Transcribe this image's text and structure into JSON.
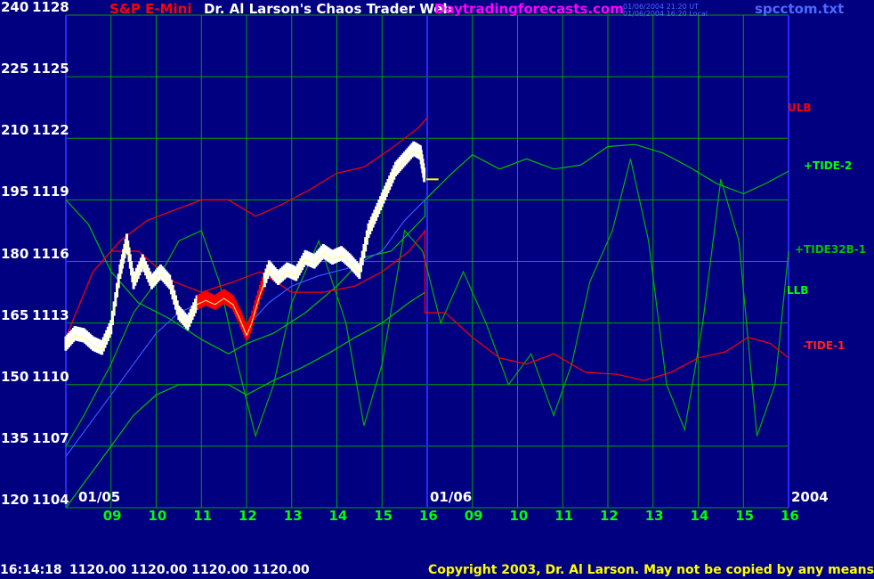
{
  "header": {
    "symbol": "S&P E-Mini",
    "title": "Dr. Al Larson's Chaos Trader Web",
    "site": "Daytradingforecasts.com",
    "stamp_ut": "01/06/2004 21:20 UT",
    "stamp_local": "01/06/2004 16:20 Local",
    "file": "spcctom.txt"
  },
  "footer": {
    "time": "16:14:18",
    "ohlc": "1120.00 1120.00 1120.00 1120.00",
    "copyright": "Copyright 2003, Dr. Al Larson. May not be copied by any means."
  },
  "colors": {
    "background": "#000080",
    "grid": "#00a000",
    "price_up": "#ffffff",
    "price_down": "#ff0000",
    "ulb_line": "#ff0000",
    "tide_line": "#00c000",
    "day_divider": "#2828ff"
  },
  "chart_data": {
    "type": "line",
    "y_labels": [
      {
        "osc": "240",
        "price": "1128"
      },
      {
        "osc": "225",
        "price": "1125"
      },
      {
        "osc": "210",
        "price": "1122"
      },
      {
        "osc": "195",
        "price": "1119"
      },
      {
        "osc": "180",
        "price": "1116"
      },
      {
        "osc": "165",
        "price": "1113"
      },
      {
        "osc": "150",
        "price": "1110"
      },
      {
        "osc": "135",
        "price": "1107"
      },
      {
        "osc": "120",
        "price": "1104"
      }
    ],
    "ylim_price": [
      1104,
      1128
    ],
    "ylim_osc": [
      120,
      240
    ],
    "x_ticks": [
      "09",
      "10",
      "11",
      "12",
      "13",
      "14",
      "15",
      "16",
      "09",
      "10",
      "11",
      "12",
      "13",
      "14",
      "15",
      "16"
    ],
    "date_labels": [
      "01/05",
      "01/06"
    ],
    "year": "2004",
    "grid": true,
    "curve_labels": [
      {
        "name": "ULB",
        "color": "#ff0000"
      },
      {
        "name": "+TIDE-2",
        "color": "#00ff00"
      },
      {
        "name": "+TIDE32B-1",
        "color": "#00c000"
      },
      {
        "name": "LLB",
        "color": "#00ff00"
      },
      {
        "name": "-TIDE-1",
        "color": "#ff2020"
      }
    ],
    "last_price": 1120.0,
    "price_series": [
      {
        "x": 0.0,
        "y": 1112.0
      },
      {
        "x": 0.2,
        "y": 1112.5
      },
      {
        "x": 0.4,
        "y": 1112.4
      },
      {
        "x": 0.6,
        "y": 1112.0
      },
      {
        "x": 0.8,
        "y": 1111.8
      },
      {
        "x": 1.0,
        "y": 1112.8
      },
      {
        "x": 1.2,
        "y": 1115.5
      },
      {
        "x": 1.35,
        "y": 1117.0
      },
      {
        "x": 1.5,
        "y": 1115.0
      },
      {
        "x": 1.7,
        "y": 1116.0
      },
      {
        "x": 1.9,
        "y": 1115.0
      },
      {
        "x": 2.1,
        "y": 1115.5
      },
      {
        "x": 2.3,
        "y": 1115.0
      },
      {
        "x": 2.5,
        "y": 1113.5
      },
      {
        "x": 2.7,
        "y": 1113.0
      },
      {
        "x": 2.9,
        "y": 1114.0
      },
      {
        "x": 3.1,
        "y": 1114.2
      },
      {
        "x": 3.3,
        "y": 1114.0
      },
      {
        "x": 3.5,
        "y": 1114.3
      },
      {
        "x": 3.7,
        "y": 1114.0
      },
      {
        "x": 3.85,
        "y": 1113.3
      },
      {
        "x": 4.0,
        "y": 1112.5
      },
      {
        "x": 4.1,
        "y": 1113.0
      },
      {
        "x": 4.3,
        "y": 1114.5
      },
      {
        "x": 4.5,
        "y": 1115.7
      },
      {
        "x": 4.7,
        "y": 1115.2
      },
      {
        "x": 4.9,
        "y": 1115.6
      },
      {
        "x": 5.1,
        "y": 1115.4
      },
      {
        "x": 5.3,
        "y": 1116.2
      },
      {
        "x": 5.5,
        "y": 1116.0
      },
      {
        "x": 5.7,
        "y": 1116.5
      },
      {
        "x": 5.9,
        "y": 1116.2
      },
      {
        "x": 6.1,
        "y": 1116.4
      },
      {
        "x": 6.3,
        "y": 1116.0
      },
      {
        "x": 6.5,
        "y": 1115.5
      },
      {
        "x": 6.7,
        "y": 1117.5
      },
      {
        "x": 6.9,
        "y": 1118.5
      },
      {
        "x": 7.1,
        "y": 1119.5
      },
      {
        "x": 7.3,
        "y": 1120.5
      },
      {
        "x": 7.5,
        "y": 1121.0
      },
      {
        "x": 7.7,
        "y": 1121.5
      },
      {
        "x": 7.85,
        "y": 1121.3
      },
      {
        "x": 7.95,
        "y": 1120.0
      }
    ],
    "ulb_series": [
      {
        "x": 0.0,
        "y": 1112.3
      },
      {
        "x": 0.6,
        "y": 1115.5
      },
      {
        "x": 1.2,
        "y": 1117.0
      },
      {
        "x": 1.8,
        "y": 1118.0
      },
      {
        "x": 2.4,
        "y": 1118.5
      },
      {
        "x": 3.0,
        "y": 1119.0
      },
      {
        "x": 3.6,
        "y": 1119.0
      },
      {
        "x": 4.2,
        "y": 1118.2
      },
      {
        "x": 4.8,
        "y": 1118.8
      },
      {
        "x": 5.4,
        "y": 1119.5
      },
      {
        "x": 6.0,
        "y": 1120.3
      },
      {
        "x": 6.6,
        "y": 1120.6
      },
      {
        "x": 7.2,
        "y": 1121.5
      },
      {
        "x": 7.8,
        "y": 1122.5
      },
      {
        "x": 8.0,
        "y": 1123.0
      }
    ],
    "price_band_series": [
      {
        "x": 1.0,
        "y": 1116.5
      },
      {
        "x": 1.6,
        "y": 1116.5
      },
      {
        "x": 2.4,
        "y": 1115.0
      },
      {
        "x": 3.0,
        "y": 1114.5
      },
      {
        "x": 3.7,
        "y": 1115.0
      },
      {
        "x": 4.3,
        "y": 1115.5
      },
      {
        "x": 5.0,
        "y": 1114.5
      },
      {
        "x": 5.7,
        "y": 1114.5
      },
      {
        "x": 6.4,
        "y": 1114.8
      },
      {
        "x": 7.0,
        "y": 1115.5
      },
      {
        "x": 7.6,
        "y": 1116.5
      },
      {
        "x": 7.95,
        "y": 1117.5
      },
      {
        "x": 7.95,
        "y": 1113.5
      },
      {
        "x": 8.4,
        "y": 1113.5
      },
      {
        "x": 9.0,
        "y": 1112.3
      },
      {
        "x": 9.6,
        "y": 1111.3
      },
      {
        "x": 10.2,
        "y": 1111.0
      },
      {
        "x": 10.8,
        "y": 1111.5
      },
      {
        "x": 11.5,
        "y": 1110.6
      },
      {
        "x": 12.2,
        "y": 1110.5
      },
      {
        "x": 12.8,
        "y": 1110.2
      },
      {
        "x": 13.4,
        "y": 1110.6
      },
      {
        "x": 14.0,
        "y": 1111.3
      },
      {
        "x": 14.6,
        "y": 1111.6
      },
      {
        "x": 15.1,
        "y": 1112.3
      },
      {
        "x": 15.6,
        "y": 1112.0
      },
      {
        "x": 16.0,
        "y": 1111.3
      }
    ],
    "tide2_series": [
      {
        "x": 0.0,
        "y": 1119.0
      },
      {
        "x": 0.5,
        "y": 1117.8
      },
      {
        "x": 1.0,
        "y": 1115.5
      },
      {
        "x": 1.6,
        "y": 1114.0
      },
      {
        "x": 2.3,
        "y": 1113.2
      },
      {
        "x": 3.0,
        "y": 1112.2
      },
      {
        "x": 3.6,
        "y": 1111.5
      },
      {
        "x": 4.0,
        "y": 1112.0
      },
      {
        "x": 4.6,
        "y": 1112.5
      },
      {
        "x": 5.3,
        "y": 1113.5
      },
      {
        "x": 6.0,
        "y": 1114.8
      },
      {
        "x": 6.6,
        "y": 1116.2
      },
      {
        "x": 7.2,
        "y": 1116.5
      },
      {
        "x": 7.95,
        "y": 1118.2
      },
      {
        "x": 7.95,
        "y": 1119.0
      },
      {
        "x": 8.5,
        "y": 1120.2
      },
      {
        "x": 9.0,
        "y": 1121.2
      },
      {
        "x": 9.6,
        "y": 1120.5
      },
      {
        "x": 10.2,
        "y": 1121.0
      },
      {
        "x": 10.8,
        "y": 1120.5
      },
      {
        "x": 11.4,
        "y": 1120.7
      },
      {
        "x": 12.0,
        "y": 1121.6
      },
      {
        "x": 12.6,
        "y": 1121.7
      },
      {
        "x": 13.2,
        "y": 1121.3
      },
      {
        "x": 13.8,
        "y": 1120.6
      },
      {
        "x": 14.4,
        "y": 1119.8
      },
      {
        "x": 15.0,
        "y": 1119.3
      },
      {
        "x": 15.5,
        "y": 1119.8
      },
      {
        "x": 16.0,
        "y": 1120.4
      }
    ],
    "tide32b_series": [
      {
        "x": 0.0,
        "y": 1107.0
      },
      {
        "x": 0.4,
        "y": 1108.5
      },
      {
        "x": 1.0,
        "y": 1111.0
      },
      {
        "x": 1.5,
        "y": 1113.5
      },
      {
        "x": 2.0,
        "y": 1115.0
      },
      {
        "x": 2.5,
        "y": 1117.0
      },
      {
        "x": 3.0,
        "y": 1117.5
      },
      {
        "x": 3.4,
        "y": 1115.0
      },
      {
        "x": 3.8,
        "y": 1111.0
      },
      {
        "x": 4.2,
        "y": 1107.5
      },
      {
        "x": 4.6,
        "y": 1110.0
      },
      {
        "x": 5.0,
        "y": 1114.0
      },
      {
        "x": 5.6,
        "y": 1117.0
      },
      {
        "x": 6.2,
        "y": 1113.0
      },
      {
        "x": 6.6,
        "y": 1108.0
      },
      {
        "x": 7.0,
        "y": 1111.0
      },
      {
        "x": 7.5,
        "y": 1117.5
      },
      {
        "x": 7.9,
        "y": 1116.5
      },
      {
        "x": 8.3,
        "y": 1113.0
      },
      {
        "x": 8.8,
        "y": 1115.5
      },
      {
        "x": 9.3,
        "y": 1113.0
      },
      {
        "x": 9.8,
        "y": 1110.0
      },
      {
        "x": 10.3,
        "y": 1111.5
      },
      {
        "x": 10.8,
        "y": 1108.5
      },
      {
        "x": 11.2,
        "y": 1111.0
      },
      {
        "x": 11.6,
        "y": 1115.0
      },
      {
        "x": 12.1,
        "y": 1117.5
      },
      {
        "x": 12.5,
        "y": 1121.0
      },
      {
        "x": 12.9,
        "y": 1117.0
      },
      {
        "x": 13.3,
        "y": 1110.0
      },
      {
        "x": 13.7,
        "y": 1107.8
      },
      {
        "x": 14.1,
        "y": 1113.0
      },
      {
        "x": 14.5,
        "y": 1120.0
      },
      {
        "x": 14.9,
        "y": 1117.0
      },
      {
        "x": 15.3,
        "y": 1107.5
      },
      {
        "x": 15.7,
        "y": 1110.0
      },
      {
        "x": 16.0,
        "y": 1116.5
      }
    ],
    "llb_series": [
      {
        "x": 0.0,
        "y": 1104.0
      },
      {
        "x": 0.5,
        "y": 1105.5
      },
      {
        "x": 1.0,
        "y": 1107.0
      },
      {
        "x": 1.5,
        "y": 1108.5
      },
      {
        "x": 2.0,
        "y": 1109.5
      },
      {
        "x": 2.5,
        "y": 1110.0
      },
      {
        "x": 3.0,
        "y": 1110.0
      },
      {
        "x": 3.6,
        "y": 1110.0
      },
      {
        "x": 4.0,
        "y": 1109.5
      },
      {
        "x": 4.6,
        "y": 1110.2
      },
      {
        "x": 5.2,
        "y": 1110.8
      },
      {
        "x": 5.8,
        "y": 1111.5
      },
      {
        "x": 6.4,
        "y": 1112.3
      },
      {
        "x": 7.0,
        "y": 1113.0
      },
      {
        "x": 7.6,
        "y": 1114.0
      },
      {
        "x": 7.95,
        "y": 1114.5
      }
    ],
    "trend_series": [
      {
        "x": 0.0,
        "y": 1106.5
      },
      {
        "x": 0.5,
        "y": 1108.0
      },
      {
        "x": 1.0,
        "y": 1109.5
      },
      {
        "x": 1.5,
        "y": 1111.0
      },
      {
        "x": 2.0,
        "y": 1112.5
      },
      {
        "x": 2.5,
        "y": 1113.5
      },
      {
        "x": 3.0,
        "y": 1114.0
      },
      {
        "x": 3.6,
        "y": 1114.2
      },
      {
        "x": 4.0,
        "y": 1112.8
      },
      {
        "x": 4.5,
        "y": 1114.0
      },
      {
        "x": 5.0,
        "y": 1114.8
      },
      {
        "x": 5.6,
        "y": 1115.3
      },
      {
        "x": 6.3,
        "y": 1115.7
      },
      {
        "x": 7.0,
        "y": 1116.5
      },
      {
        "x": 7.5,
        "y": 1118.0
      },
      {
        "x": 7.95,
        "y": 1119.0
      }
    ]
  }
}
